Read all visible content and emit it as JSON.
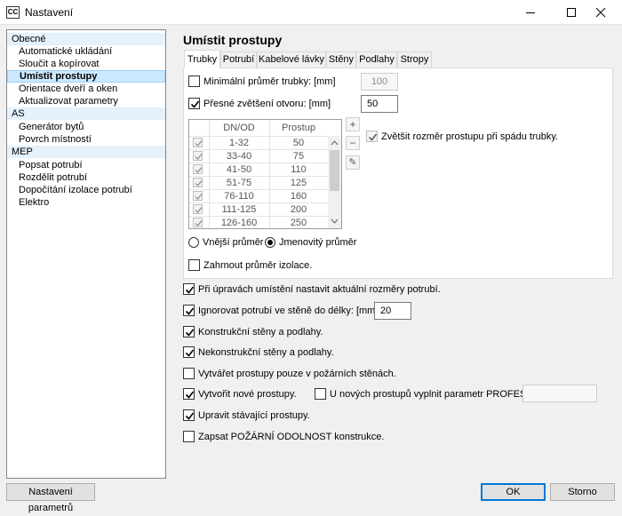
{
  "window": {
    "icon_text": "CC",
    "title": "Nastavení"
  },
  "nav": {
    "items": [
      {
        "label": "Obecné",
        "type": "cat"
      },
      {
        "label": "Automatické ukládání",
        "type": "sub"
      },
      {
        "label": "Sloučit a kopírovat",
        "type": "sub"
      },
      {
        "label": "Umístit prostupy",
        "type": "sel"
      },
      {
        "label": "Orientace dveří a oken",
        "type": "sub"
      },
      {
        "label": "Aktualizovat parametry",
        "type": "sub"
      },
      {
        "label": "AS",
        "type": "cat"
      },
      {
        "label": "Generátor bytů",
        "type": "sub"
      },
      {
        "label": "Povrch místností",
        "type": "sub"
      },
      {
        "label": "MEP",
        "type": "cat"
      },
      {
        "label": "Popsat potrubí",
        "type": "sub"
      },
      {
        "label": "Rozdělit potrubí",
        "type": "sub"
      },
      {
        "label": "Dopočítání izolace potrubí",
        "type": "sub"
      },
      {
        "label": "Elektro",
        "type": "sub"
      }
    ]
  },
  "page_title": "Umístit prostupy",
  "tabs": [
    "Trubky",
    "Potrubí",
    "Kabelové lávky",
    "Stěny",
    "Podlahy",
    "Stropy"
  ],
  "trubky": {
    "min_diameter": {
      "label": "Minimální průměr trubky: [mm]",
      "value": "100",
      "checked": false
    },
    "exact_enlarge": {
      "label": "Přesné zvětšení otvoru: [mm]",
      "value": "50",
      "checked": true
    },
    "grid": {
      "headers": [
        "DN/OD",
        "Prostup"
      ],
      "rows": [
        [
          "1-32",
          "50"
        ],
        [
          "33-40",
          "75"
        ],
        [
          "41-50",
          "110"
        ],
        [
          "51-75",
          "125"
        ],
        [
          "76-110",
          "160"
        ],
        [
          "111-125",
          "200"
        ],
        [
          "126-160",
          "250"
        ]
      ]
    },
    "side_buttons": [
      "+",
      "−",
      "✎"
    ],
    "enlarge_slope": {
      "label": "Zvětšit rozměr prostupu při spádu trubky.",
      "checked": true
    },
    "radio_outer": "Vnější průměr",
    "radio_nominal": "Jmenovitý průměr",
    "include_insulation": {
      "label": "Zahrnout průměr izolace.",
      "checked": false
    }
  },
  "options": [
    {
      "label": "Při úpravách umístění nastavit aktuální rozměry potrubí.",
      "checked": true
    },
    {
      "label": "Ignorovat potrubí ve stěně do délky: [mm]",
      "checked": true,
      "value": "20"
    },
    {
      "label": "Konstrukční stěny a podlahy.",
      "checked": true
    },
    {
      "label": "Nekonstrukční stěny a podlahy.",
      "checked": true
    },
    {
      "label": "Vytvářet prostupy pouze v požárních stěnách.",
      "checked": false
    },
    {
      "label": "Vytvořit nové prostupy.",
      "checked": true
    },
    {
      "label": "Upravit stávající prostupy.",
      "checked": true
    },
    {
      "label": "Zapsat POŽÁRNÍ ODOLNOST konstrukce.",
      "checked": false
    }
  ],
  "profese": {
    "label": "U nových prostupů vyplnit parametr PROFESE",
    "checked": false,
    "value": ""
  },
  "buttons": {
    "settings": "Nastavení parametrů",
    "ok": "OK",
    "cancel": "Storno"
  }
}
